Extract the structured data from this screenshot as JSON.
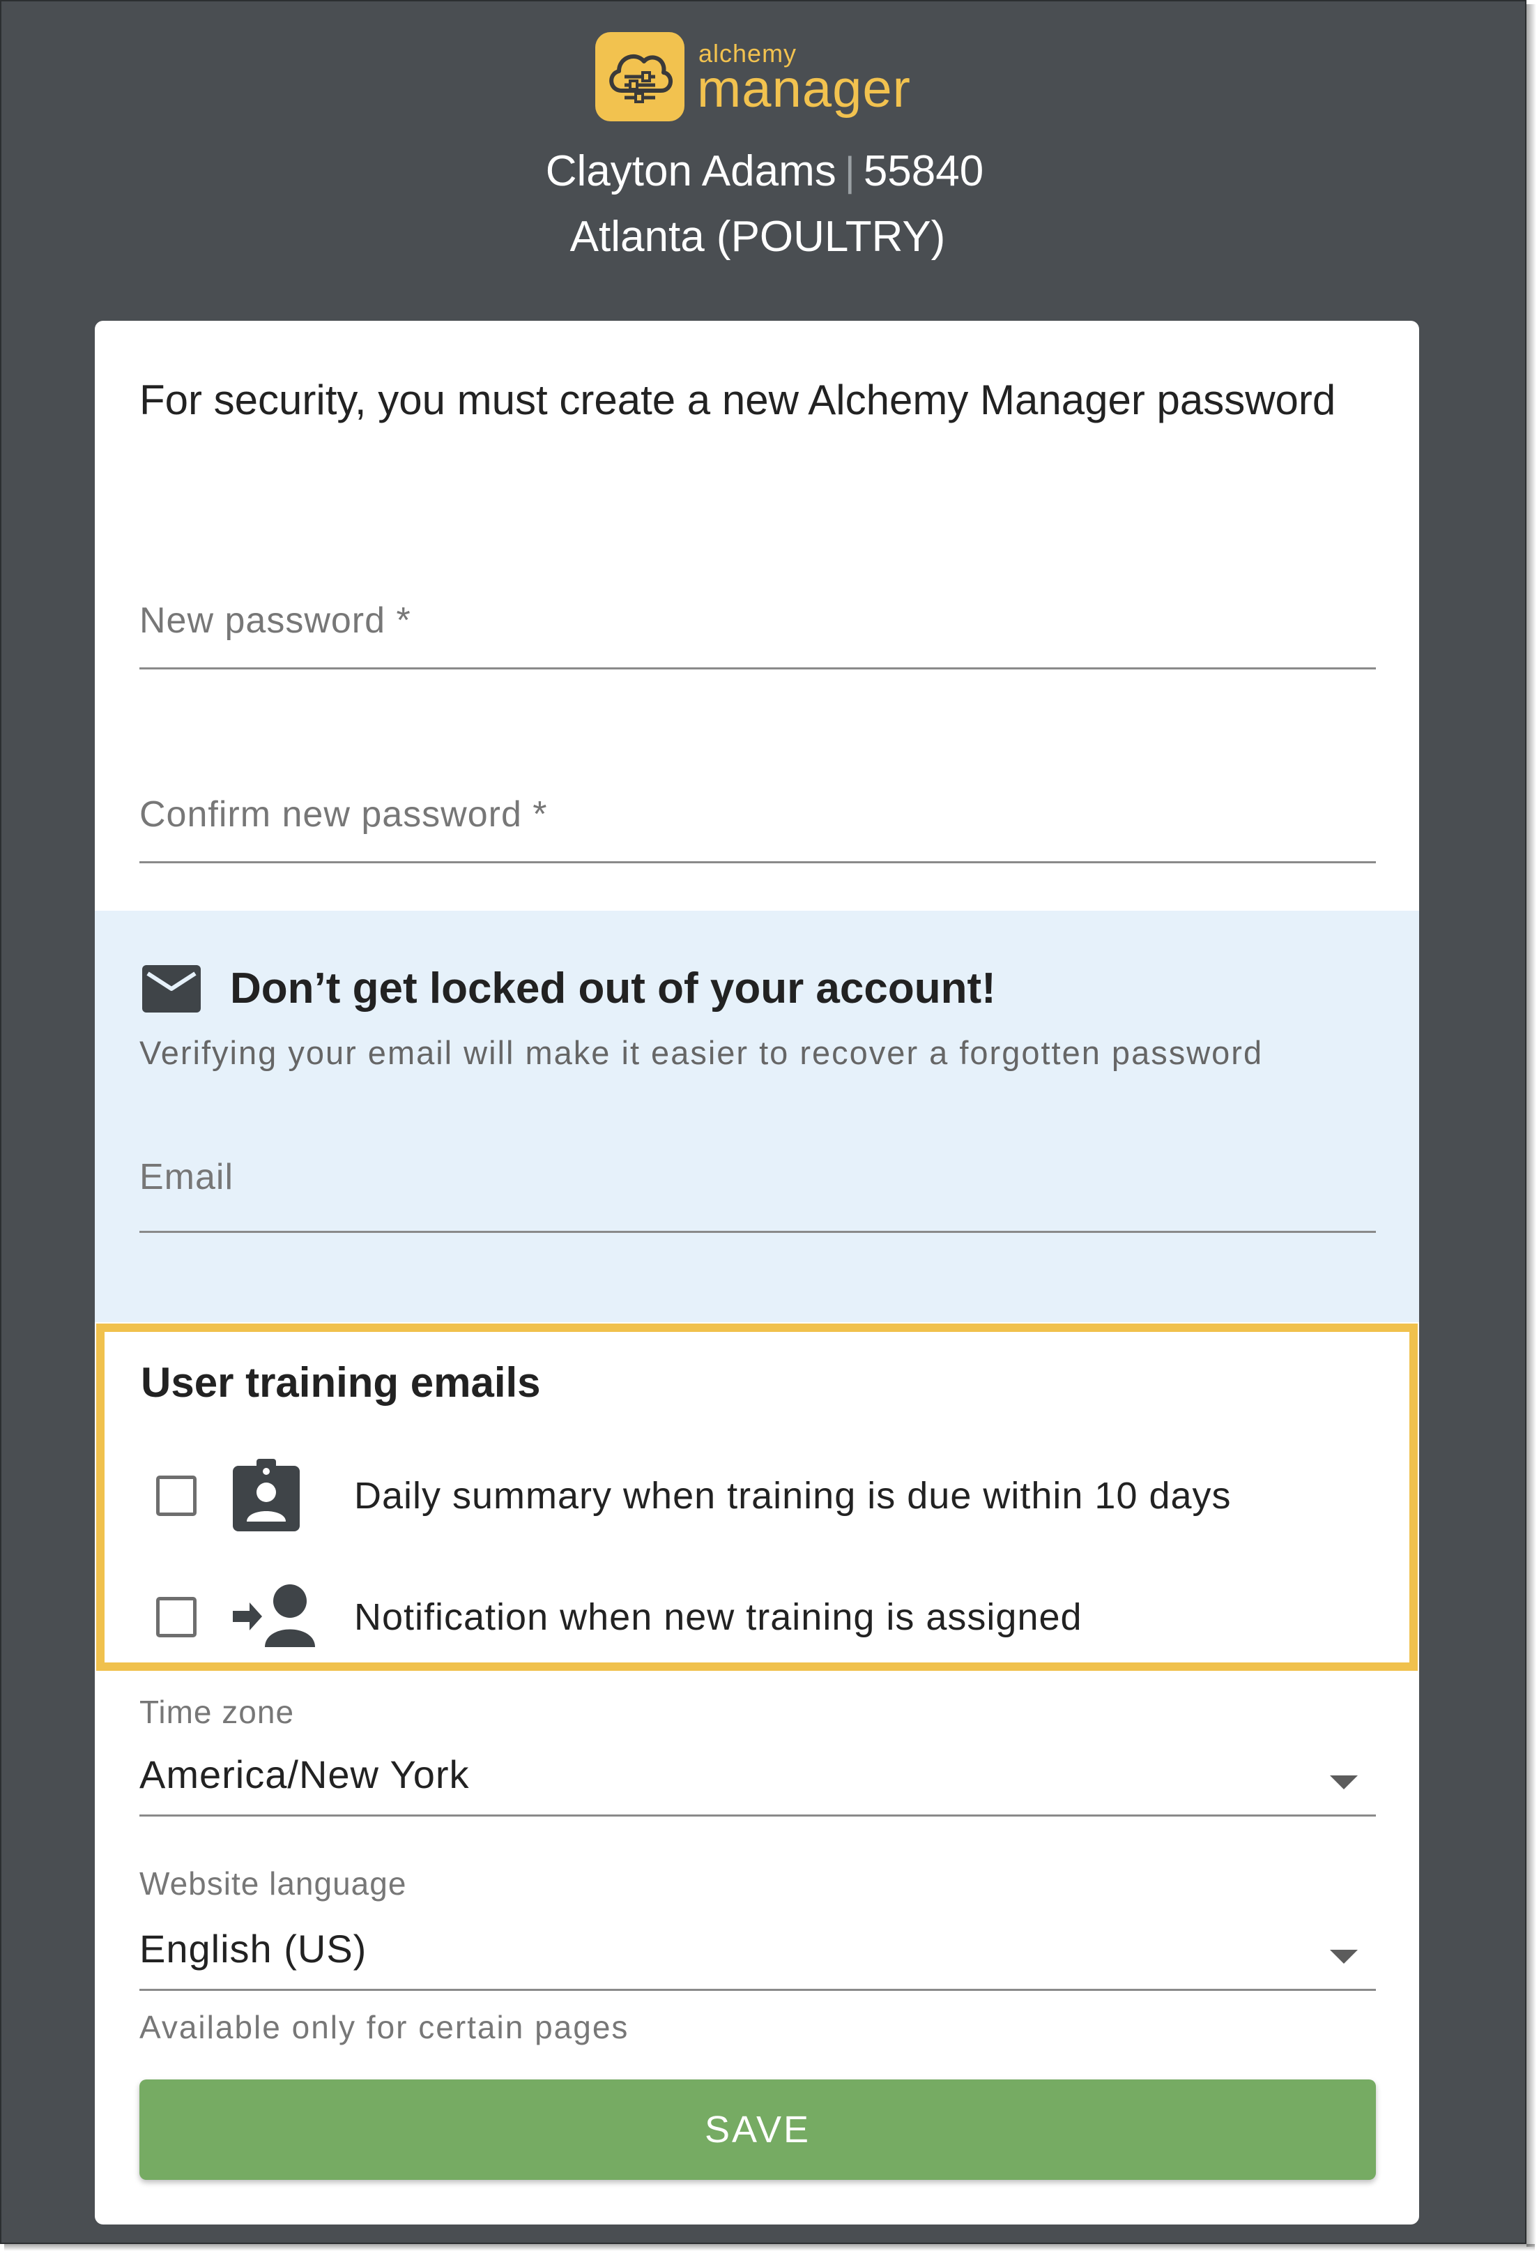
{
  "header": {
    "logo_small": "alchemy",
    "logo_big": "manager",
    "user_name": "Clayton Adams",
    "separator": "|",
    "user_id": "55840",
    "location": "Atlanta (POULTRY)"
  },
  "form": {
    "intro": "For security, you must create a new Alchemy Manager password",
    "new_password_placeholder": "New password *",
    "confirm_password_placeholder": "Confirm new password *"
  },
  "email_section": {
    "icon": "mail-icon",
    "title": "Don’t get locked out of your account!",
    "subtitle": "Verifying your email will make it easier to recover a forgotten password",
    "email_placeholder": "Email"
  },
  "training": {
    "title": "User training emails",
    "options": [
      {
        "icon": "assignment-ind-icon",
        "label": "Daily summary when training is due within 10 days",
        "checked": false
      },
      {
        "icon": "person-add-arrow-icon",
        "label": "Notification when new training is assigned",
        "checked": false
      }
    ],
    "highlight_color": "#f0c14d"
  },
  "timezone": {
    "label": "Time zone",
    "value": "America/New York"
  },
  "language": {
    "label": "Website language",
    "value": "English (US)",
    "helper": "Available only for certain pages"
  },
  "save_label": "SAVE",
  "colors": {
    "background": "#4a4e52",
    "brand_yellow": "#f2c24f",
    "save_green": "#76ab63",
    "info_blue": "#e6f1fa"
  }
}
